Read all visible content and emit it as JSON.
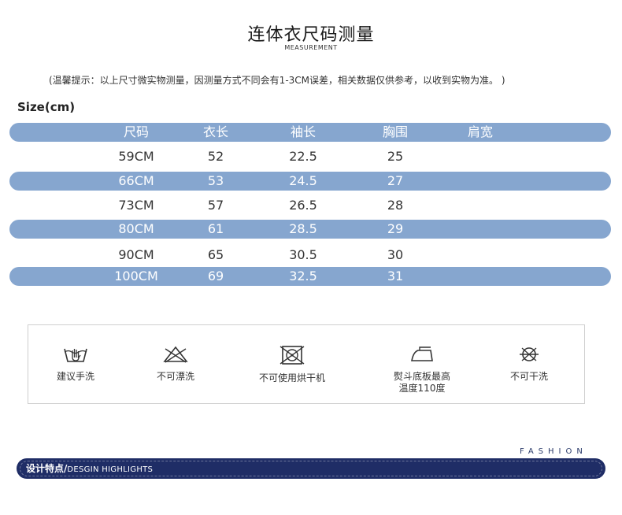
{
  "header": {
    "title": "连体衣尺码测量",
    "subtitle": "MEASUREMENT",
    "note": "(温馨提示：以上尺寸微实物测量，因测量方式不同会有1-3CM误差，相关数据仅供参考，以收到实物为准。 )",
    "size_label": "Size(cm)"
  },
  "table": {
    "columns": [
      "尺码",
      "衣长",
      "袖长",
      "胸围",
      "肩宽"
    ],
    "rows": [
      [
        "59CM",
        "52",
        "22.5",
        "25",
        ""
      ],
      [
        "66CM",
        "53",
        "24.5",
        "27",
        ""
      ],
      [
        "73CM",
        "57",
        "26.5",
        "28",
        ""
      ],
      [
        "80CM",
        "61",
        "28.5",
        "29",
        ""
      ],
      [
        "90CM",
        "65",
        "30.5",
        "30",
        ""
      ],
      [
        "100CM",
        "69",
        "32.5",
        "31",
        ""
      ]
    ]
  },
  "care": [
    {
      "icon": "hand-wash-icon",
      "label": "建议手洗"
    },
    {
      "icon": "no-bleach-icon",
      "label": "不可漂洗"
    },
    {
      "icon": "no-tumble-dry-icon",
      "label": "不可使用烘干机"
    },
    {
      "icon": "iron-icon",
      "label": "熨斗底板最高\n温度110度"
    },
    {
      "icon": "no-dry-clean-icon",
      "label": "不可干洗"
    }
  ],
  "footer": {
    "fashion": "FASHION",
    "banner_cn": "设计特点/",
    "banner_en": "DESGIN HIGHLIGHTS"
  },
  "colors": {
    "band": "#86a6cf",
    "banner": "#1f2d66"
  }
}
